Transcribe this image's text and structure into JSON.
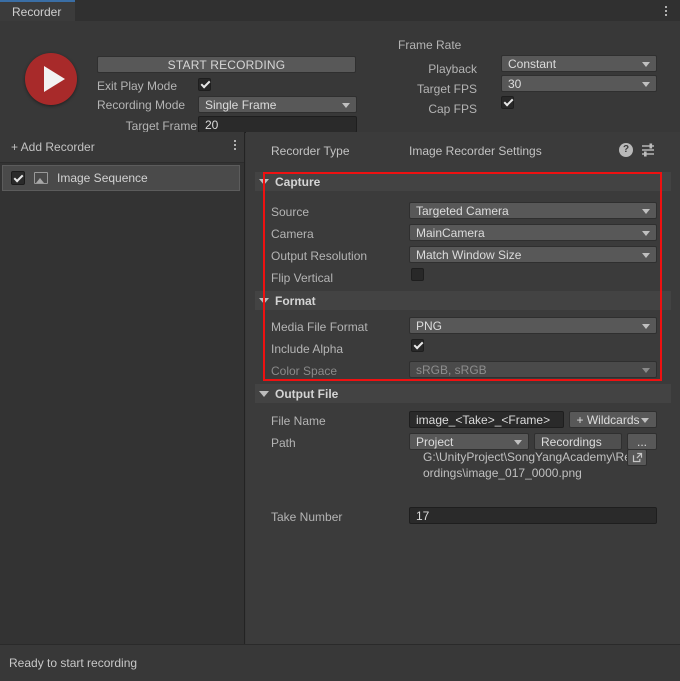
{
  "window": {
    "tab_label": "Recorder",
    "menu_icon": "kebab-menu-icon"
  },
  "controls": {
    "record_button_icon": "play-record-icon",
    "start_recording_label": "START RECORDING",
    "exit_play_mode_label": "Exit Play Mode",
    "exit_play_mode_checked": "true",
    "recording_mode_label": "Recording Mode",
    "recording_mode_value": "Single Frame",
    "target_frame_label": "Target Frame",
    "target_frame_value": "20"
  },
  "frame_rate": {
    "title": "Frame Rate",
    "playback_label": "Playback",
    "playback_value": "Constant",
    "target_fps_label": "Target FPS",
    "target_fps_value": "30",
    "cap_fps_label": "Cap FPS",
    "cap_fps_checked": "true"
  },
  "recorder_list": {
    "add_recorder_label": "+ Add Recorder",
    "menu_icon": "kebab-menu-icon",
    "items": [
      {
        "label": "Image Sequence",
        "enabled": "true",
        "icon": "image-sequence-icon"
      }
    ]
  },
  "settings": {
    "recorder_type_label": "Recorder Type",
    "recorder_type_value": "Image Recorder Settings",
    "help_icon": "help-icon",
    "help_glyph": "?",
    "preset_icon": "preset-settings-icon",
    "capture": {
      "title": "Capture",
      "source_label": "Source",
      "source_value": "Targeted Camera",
      "camera_label": "Camera",
      "camera_value": "MainCamera",
      "output_resolution_label": "Output Resolution",
      "output_resolution_value": "Match Window Size",
      "flip_vertical_label": "Flip Vertical",
      "flip_vertical_checked": "false"
    },
    "format": {
      "title": "Format",
      "media_file_format_label": "Media File Format",
      "media_file_format_value": "PNG",
      "include_alpha_label": "Include Alpha",
      "include_alpha_checked": "true",
      "color_space_label": "Color Space",
      "color_space_value": "sRGB, sRGB",
      "color_space_disabled": "true"
    },
    "output_file": {
      "title": "Output File",
      "file_name_label": "File Name",
      "file_name_value": "image_<Take>_<Frame>",
      "wildcards_label": "+ Wildcards",
      "path_label": "Path",
      "path_root_value": "Project",
      "path_folder_value": "Recordings",
      "browse_label": "...",
      "resolved_path": "G:\\UnityProject\\SongYangAcademy\\Recordings\\image_017_0000.png",
      "open_icon": "open-external-icon",
      "take_number_label": "Take Number",
      "take_number_value": "17"
    }
  },
  "annotation": {
    "highlight_color": "#ee1111"
  },
  "status": {
    "message": "Ready to start recording"
  }
}
